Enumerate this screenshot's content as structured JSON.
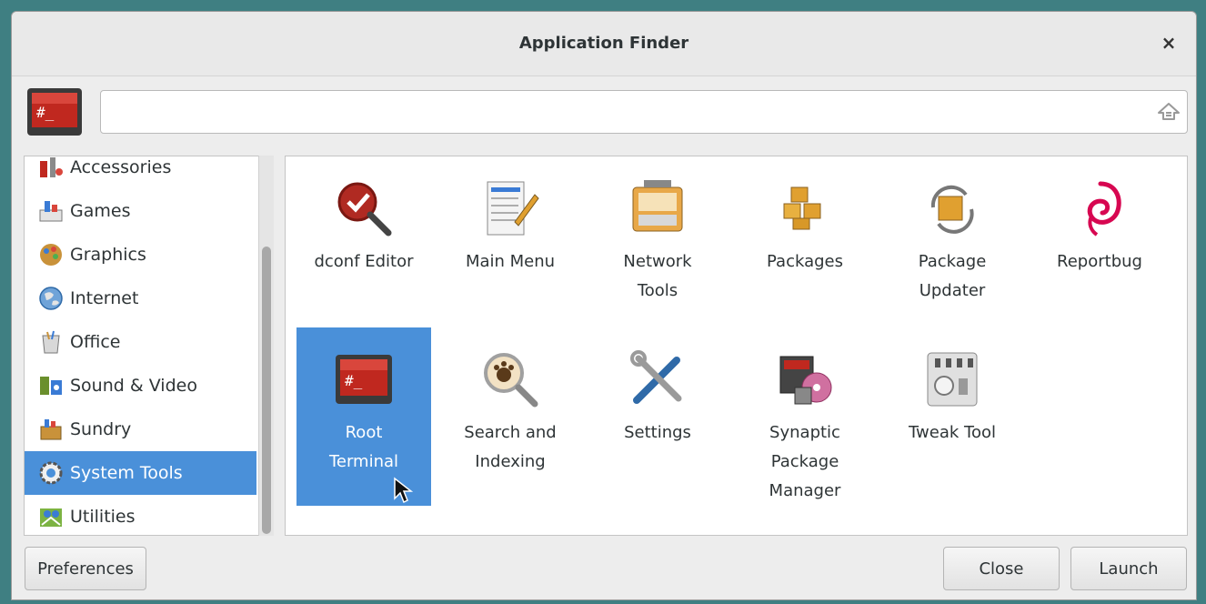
{
  "window": {
    "title": "Application Finder",
    "close_glyph": "×"
  },
  "search": {
    "value": "",
    "placeholder": "",
    "clear_icon": "clear-icon",
    "app_icon": "root-terminal-icon"
  },
  "sidebar": {
    "items": [
      {
        "label": "Accessories",
        "icon": "accessories-icon"
      },
      {
        "label": "Games",
        "icon": "games-icon"
      },
      {
        "label": "Graphics",
        "icon": "graphics-icon"
      },
      {
        "label": "Internet",
        "icon": "internet-icon"
      },
      {
        "label": "Office",
        "icon": "office-icon"
      },
      {
        "label": "Sound & Video",
        "icon": "sound-video-icon"
      },
      {
        "label": "Sundry",
        "icon": "sundry-icon"
      },
      {
        "label": "System Tools",
        "icon": "system-tools-icon",
        "selected": true
      },
      {
        "label": "Utilities",
        "icon": "utilities-icon"
      }
    ]
  },
  "apps": [
    {
      "label": "dconf Editor",
      "icon": "dconf-editor-icon"
    },
    {
      "label": "Main Menu",
      "icon": "main-menu-icon"
    },
    {
      "label": "Network\nTools",
      "icon": "network-tools-icon"
    },
    {
      "label": "Packages",
      "icon": "packages-icon"
    },
    {
      "label": "Package\nUpdater",
      "icon": "package-updater-icon"
    },
    {
      "label": "Reportbug",
      "icon": "reportbug-icon"
    },
    {
      "label": "Root\nTerminal",
      "icon": "root-terminal-icon",
      "selected": true
    },
    {
      "label": "Search and\nIndexing",
      "icon": "search-indexing-icon"
    },
    {
      "label": "Settings",
      "icon": "settings-icon"
    },
    {
      "label": "Synaptic\nPackage\nManager",
      "icon": "synaptic-icon"
    },
    {
      "label": "Tweak Tool",
      "icon": "tweak-tool-icon"
    }
  ],
  "buttons": {
    "preferences": "Preferences",
    "close": "Close",
    "launch": "Launch"
  },
  "colors": {
    "desktop": "#3f7f82",
    "selection": "#4a90d9",
    "terminal_red": "#c0281f"
  }
}
